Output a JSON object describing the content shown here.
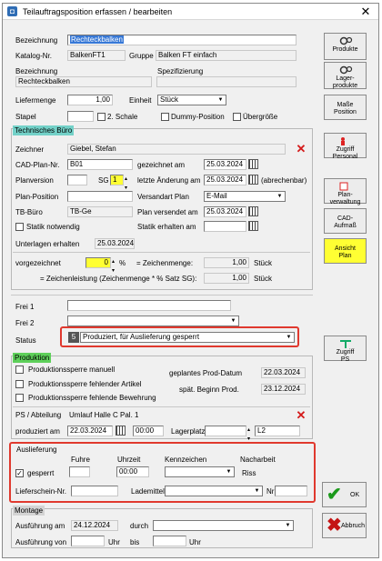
{
  "window": {
    "title": "Teilauftragsposition erfassen / bearbeiten",
    "close": "✕"
  },
  "top": {
    "bezeichnung_label": "Bezeichnung",
    "bezeichnung_value": "Rechteckbalken",
    "katalog_label": "Katalog-Nr.",
    "katalog_value": "BalkenFT1",
    "gruppe_label": "Gruppe",
    "gruppe_value": "Balken FT einfach",
    "bez2_label": "Bezeichnung",
    "spez_label": "Spezifizierung",
    "bez2_value": "Rechteckbalken",
    "liefermenge_label": "Liefermenge",
    "liefermenge_value": "1,00",
    "einheit_label": "Einheit",
    "einheit_value": "Stück",
    "stapel_label": "Stapel",
    "schale_label": "2. Schale",
    "dummy_label": "Dummy-Position",
    "uebergroesse_label": "Übergröße"
  },
  "tb": {
    "title": "Technisches Büro",
    "zeichner_label": "Zeichner",
    "zeichner_value": "Giebel, Stefan",
    "cad_label": "CAD-Plan-Nr.",
    "cad_value": "B01",
    "gezeichnet_label": "gezeichnet am",
    "gezeichnet_value": "25.03.2024",
    "planversion_label": "Planversion",
    "sg_label": "SG",
    "sg_value": "1",
    "letzte_label": "letzte Änderung am",
    "letzte_value": "25.03.2024",
    "abrechenbar_label": "(abrechenbar)",
    "planpos_label": "Plan-Position",
    "versandart_label": "Versandart Plan",
    "versandart_value": "E-Mail",
    "tbbuero_label": "TB-Büro",
    "tbbuero_value": "TB-Ge",
    "versendet_label": "Plan versendet am",
    "versendet_value": "25.03.2024",
    "statik_notw_label": "Statik notwendig",
    "statik_erh_label": "Statik erhalten am",
    "unterlagen_label": "Unterlagen erhalten",
    "unterlagen_value": "25.03.2024",
    "vorgezeichnet_label": "vorgezeichnet",
    "vorgezeichnet_value": "0",
    "pct": "%",
    "zmenge_label": "= Zeichenmenge:",
    "zmenge_value": "1,00",
    "zmenge_unit": "Stück",
    "zleistung_label": "= Zeichenleistung (Zeichenmenge * % Satz SG):",
    "zleistung_value": "1,00",
    "zleistung_unit": "Stück"
  },
  "frei": {
    "frei1_label": "Frei 1",
    "frei2_label": "Frei 2",
    "status_label": "Status",
    "status_num": "5",
    "status_value": "Produziert, für Auslieferung gesperrt"
  },
  "prod": {
    "title": "Produktion",
    "sperre1": "Produktionssperre manuell",
    "sperre2": "Produktionssperre fehlender Artikel",
    "sperre3": "Produktionssperre fehlende Bewehrung",
    "geplantes_label": "geplantes Prod-Datum",
    "geplantes_value": "22.03.2024",
    "spaet_label": "spät. Beginn Prod.",
    "spaet_value": "23.12.2024",
    "ps_label": "PS / Abteilung",
    "ps_value": "Umlauf Halle C Pal. 1",
    "produziert_label": "produziert am",
    "produziert_date": "22.03.2024",
    "produziert_time": "00:00",
    "lagerplatz_label": "Lagerplatz",
    "lagerplatz_value": "L2"
  },
  "auslieferung": {
    "title": "Auslieferung",
    "fuhre_label": "Fuhre",
    "uhrzeit_label": "Uhrzeit",
    "kennzeichen_label": "Kennzeichen",
    "nacharbeit_label": "Nacharbeit",
    "gesperrt_label": "gesperrt",
    "uhrzeit_value": "00:00",
    "riss_label": "Riss",
    "lieferschein_label": "Lieferschein-Nr.",
    "lademittel_label": "Lademittel",
    "nr_label": "Nr"
  },
  "montage": {
    "title": "Montage",
    "ausfuehrung_am_label": "Ausführung am",
    "ausfuehrung_am_value": "24.12.2024",
    "durch_label": "durch",
    "ausfuehrung_von_label": "Ausführung von",
    "uhr1": "Uhr",
    "bis": "bis",
    "uhr2": "Uhr"
  },
  "buttons": {
    "produkte": "Produkte",
    "lager1": "Lager-",
    "lager2": "produkte",
    "masse1": "Maße",
    "masse2": "Position",
    "zugriff_personal1": "Zugriff",
    "zugriff_personal2": "Personal",
    "planverwaltung1": "Plan-",
    "planverwaltung2": "verwaltung",
    "cad1": "CAD-",
    "cad2": "Aufmaß",
    "ansicht1": "Ansicht",
    "ansicht2": "Plan",
    "zugriff_ps1": "Zugriff",
    "zugriff_ps2": "PS",
    "ok": "OK",
    "abbruch": "Abbruch"
  },
  "colors": {
    "teal_header": "#73d1c8",
    "green_header": "#5ed05a",
    "highlight": "#e0392e",
    "ansicht_btn": "#ffff33",
    "selected_text_bg": "#3778d6"
  }
}
